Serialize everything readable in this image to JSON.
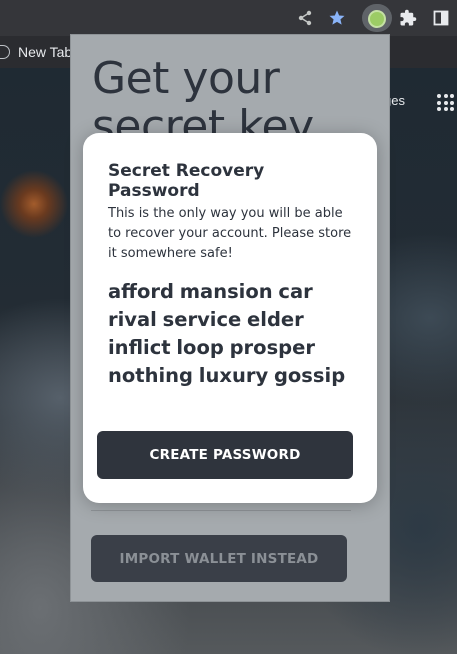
{
  "browser": {
    "bookmarks_bar": {
      "new_tab_label": "New Tab"
    },
    "icons": [
      "share-icon",
      "star-icon",
      "extension-icon",
      "puzzle-icon",
      "sidebar-icon"
    ],
    "accent_color": "#8ab4f8"
  },
  "new_tab_page": {
    "link_label": "ges",
    "apps_icon": "grid-icon"
  },
  "popup": {
    "title": "Get your secret key",
    "import_button_label": "IMPORT WALLET INSTEAD"
  },
  "modal": {
    "title": "Secret Recovery Password",
    "description": "This is the only way you will be able to recover your account. Please store it somewhere safe!",
    "phrase": "afford mansion car rival service elder inflict loop prosper nothing luxury gossip",
    "create_button_label": "CREATE PASSWORD"
  }
}
